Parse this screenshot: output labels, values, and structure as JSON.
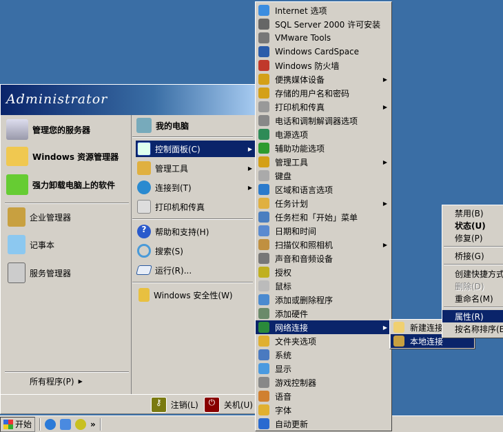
{
  "start_menu": {
    "user": "Administrator",
    "pinned": [
      {
        "label": "管理您的服务器",
        "icon": "server-icon"
      },
      {
        "label": "Windows 资源管理器",
        "icon": "explorer-icon"
      },
      {
        "label": "强力卸载电脑上的软件",
        "icon": "uninstall-icon"
      }
    ],
    "recent": [
      {
        "label": "企业管理器",
        "icon": "enterprise-manager-icon"
      },
      {
        "label": "记事本",
        "icon": "notepad-icon"
      },
      {
        "label": "服务管理器",
        "icon": "service-manager-icon"
      }
    ],
    "all_programs": "所有程序(P)",
    "right": [
      {
        "label": "我的电脑",
        "icon": "computer-icon"
      },
      {
        "label": "控制面板(C)",
        "icon": "control-panel-icon",
        "submenu": true
      },
      {
        "label": "管理工具",
        "icon": "admin-tools-icon",
        "submenu": true
      },
      {
        "label": "连接到(T)",
        "icon": "connect-icon",
        "submenu": true
      },
      {
        "label": "打印机和传真",
        "icon": "printer-icon"
      },
      {
        "label": "帮助和支持(H)",
        "icon": "help-icon"
      },
      {
        "label": "搜索(S)",
        "icon": "search-icon"
      },
      {
        "label": "运行(R)...",
        "icon": "run-icon"
      },
      {
        "label": "Windows 安全性(W)",
        "icon": "lock-icon"
      }
    ],
    "logoff": "注销(L)",
    "shutdown": "关机(U)"
  },
  "taskbar": {
    "start": "开始",
    "chevron": "»"
  },
  "control_panel": [
    {
      "label": "Internet 选项",
      "color": "#3b8de0"
    },
    {
      "label": "SQL Server 2000 许可安装",
      "color": "#666"
    },
    {
      "label": "VMware Tools",
      "color": "#777"
    },
    {
      "label": "Windows CardSpace",
      "color": "#2a5caa"
    },
    {
      "label": "Windows 防火墙",
      "color": "#c0392b"
    },
    {
      "label": "便携媒体设备",
      "color": "#d4a017",
      "submenu": true
    },
    {
      "label": "存储的用户名和密码",
      "color": "#d4a017"
    },
    {
      "label": "打印机和传真",
      "color": "#999",
      "submenu": true
    },
    {
      "label": "电话和调制解调器选项",
      "color": "#888"
    },
    {
      "label": "电源选项",
      "color": "#2e8b57"
    },
    {
      "label": "辅助功能选项",
      "color": "#2e9b2e"
    },
    {
      "label": "管理工具",
      "color": "#d4a017",
      "submenu": true
    },
    {
      "label": "键盘",
      "color": "#aaa"
    },
    {
      "label": "区域和语言选项",
      "color": "#2a7acc"
    },
    {
      "label": "任务计划",
      "color": "#e0b040",
      "submenu": true
    },
    {
      "label": "任务栏和「开始」菜单",
      "color": "#4a7ec0"
    },
    {
      "label": "日期和时间",
      "color": "#5a8ad0"
    },
    {
      "label": "扫描仪和照相机",
      "color": "#c09040",
      "submenu": true
    },
    {
      "label": "声音和音频设备",
      "color": "#777"
    },
    {
      "label": "授权",
      "color": "#c0b020"
    },
    {
      "label": "鼠标",
      "color": "#bbb"
    },
    {
      "label": "添加或删除程序",
      "color": "#4a8ad0"
    },
    {
      "label": "添加硬件",
      "color": "#6a8a6a"
    },
    {
      "label": "网络连接",
      "color": "#2a8a3a",
      "submenu": true,
      "selected": true
    },
    {
      "label": "文件夹选项",
      "color": "#e0b030"
    },
    {
      "label": "系统",
      "color": "#4a7ac0"
    },
    {
      "label": "显示",
      "color": "#4a9ae0"
    },
    {
      "label": "游戏控制器",
      "color": "#888"
    },
    {
      "label": "语音",
      "color": "#d08030"
    },
    {
      "label": "字体",
      "color": "#e0b030"
    },
    {
      "label": "自动更新",
      "color": "#2a6ad0"
    }
  ],
  "network_connections": [
    {
      "label": "新建连接"
    },
    {
      "label": "本地连接",
      "selected": true
    }
  ],
  "context_menu": [
    {
      "label": "禁用(B)"
    },
    {
      "label": "状态(U)",
      "bold": true
    },
    {
      "label": "修复(P)"
    },
    {
      "sep": true
    },
    {
      "label": "桥接(G)"
    },
    {
      "sep": true
    },
    {
      "label": "创建快捷方式"
    },
    {
      "label": "删除(D)",
      "disabled": true
    },
    {
      "label": "重命名(M)"
    },
    {
      "sep": true
    },
    {
      "label": "属性(R)",
      "selected": true
    },
    {
      "label": "按名称排序(E)"
    }
  ]
}
